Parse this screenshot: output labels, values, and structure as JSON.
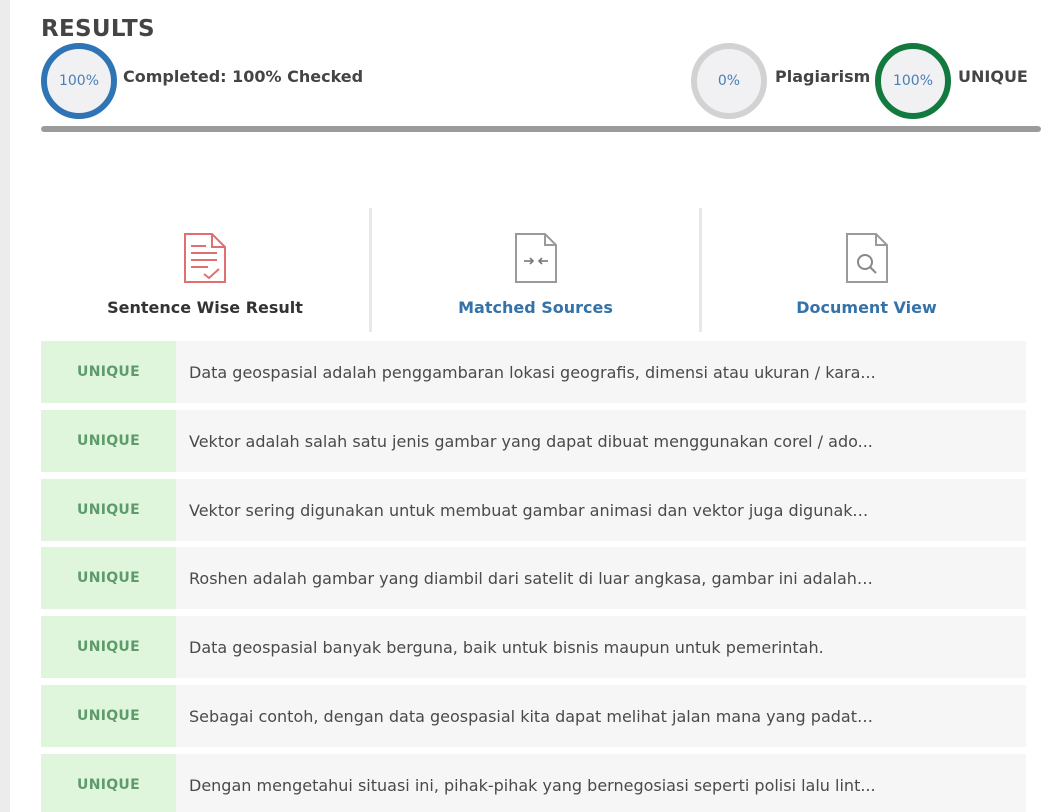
{
  "header": {
    "title": "RESULTS"
  },
  "summary": {
    "completed": {
      "ring_text": "100%",
      "label": "Completed: 100% Checked"
    },
    "plagiarism": {
      "ring_text": "0%",
      "label": "Plagiarism"
    },
    "unique": {
      "ring_text": "100%",
      "label": "UNIQUE"
    },
    "progress_percent": 100
  },
  "tabs": [
    {
      "label": "Sentence Wise Result",
      "icon": "document-check-icon"
    },
    {
      "label": "Matched Sources",
      "icon": "compare-icon"
    },
    {
      "label": "Document View",
      "icon": "document-search-icon"
    }
  ],
  "results": [
    {
      "status": "UNIQUE",
      "text": "Data geospasial adalah penggambaran lokasi geografis, dimensi atau ukuran / kara..."
    },
    {
      "status": "UNIQUE",
      "text": "Vektor adalah salah satu jenis gambar yang dapat dibuat menggunakan corel / ado..."
    },
    {
      "status": "UNIQUE",
      "text": "Vektor sering digunakan untuk membuat gambar animasi dan vektor juga digunaka..."
    },
    {
      "status": "UNIQUE",
      "text": "Roshen adalah gambar yang diambil dari satelit di luar angkasa, gambar ini adalah ..."
    },
    {
      "status": "UNIQUE",
      "text": "Data geospasial banyak berguna, baik untuk bisnis maupun untuk pemerintah."
    },
    {
      "status": "UNIQUE",
      "text": "Sebagai contoh, dengan data geospasial kita dapat melihat jalan mana yang padat ..."
    },
    {
      "status": "UNIQUE",
      "text": "Dengan mengetahui situasi ini, pihak-pihak yang bernegosiasi seperti polisi lalu lint..."
    }
  ],
  "colors": {
    "completed_ring": "#2f74b5",
    "plagiarism_ring": "#d2d2d2",
    "unique_ring": "#127a3f",
    "unique_badge_bg": "#e0f6dc",
    "unique_badge_text": "#5d9b6b",
    "link": "#3572a8"
  }
}
